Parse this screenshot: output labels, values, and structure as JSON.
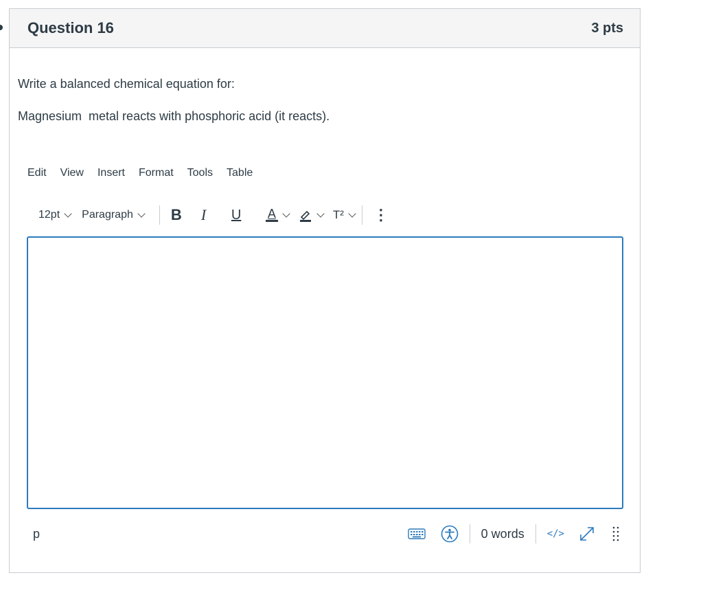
{
  "question": {
    "title": "Question 16",
    "points": "3 pts",
    "prompt_line1": "Write a balanced chemical equation for:",
    "prompt_line2": "Magnesium  metal reacts with phosphoric acid (it reacts)."
  },
  "editor": {
    "menu": [
      "Edit",
      "View",
      "Insert",
      "Format",
      "Tools",
      "Table"
    ],
    "font_size": "12pt",
    "block_format": "Paragraph",
    "bold_label": "B",
    "italic_label": "I",
    "underline_label": "U",
    "text_color_label": "A",
    "superscript_label": "T²",
    "more_label": "⋮",
    "content": "",
    "path": "p",
    "word_count": "0 words",
    "html_editor_label": "</>"
  },
  "colors": {
    "accent": "#2b7abc",
    "text": "#2d3b45",
    "border": "#c7cdd1"
  },
  "icons": [
    "chevron-down-icon",
    "highlighter-icon",
    "keyboard-icon",
    "accessibility-icon",
    "expand-icon",
    "resize-handle-icon"
  ]
}
